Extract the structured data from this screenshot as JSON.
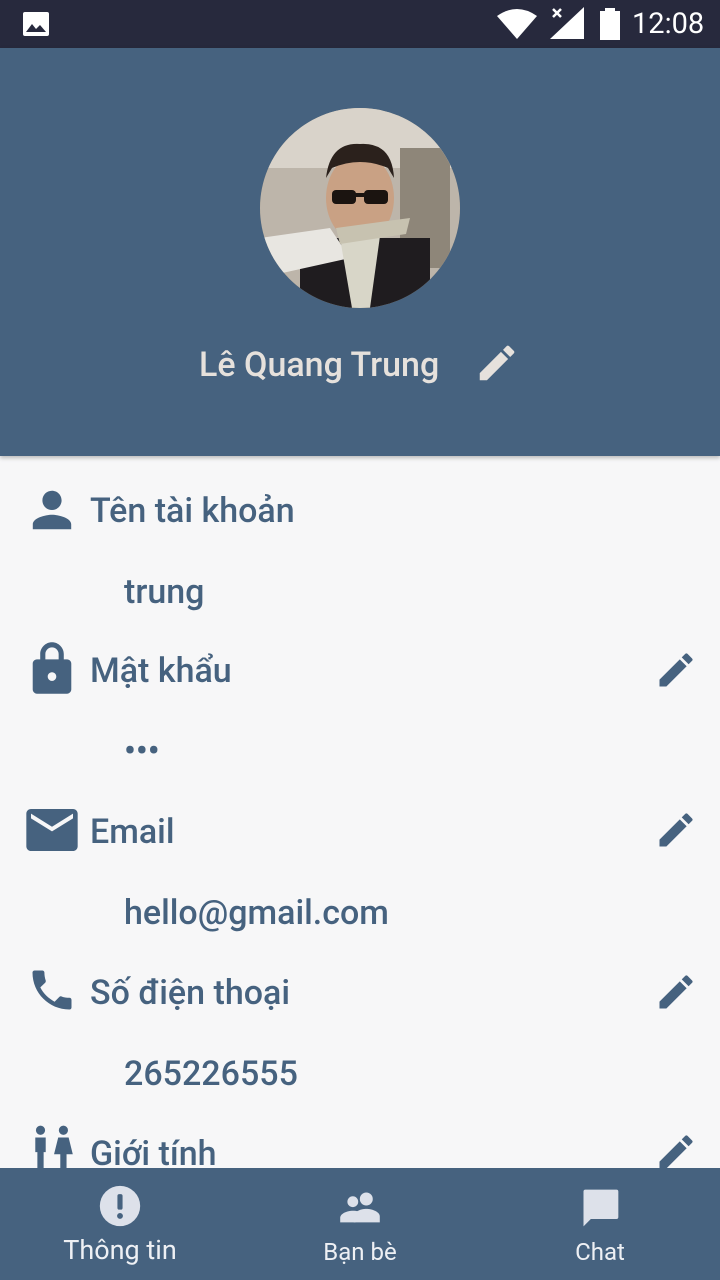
{
  "status_bar": {
    "time": "12:08",
    "icons": [
      "image-icon",
      "wifi-icon",
      "signal-icon",
      "battery-icon"
    ]
  },
  "profile": {
    "name": "Lê Quang Trung",
    "avatar": "profile-photo"
  },
  "fields": [
    {
      "icon": "person-icon",
      "label": "Tên tài khoản",
      "value": "trung",
      "editable": false
    },
    {
      "icon": "lock-icon",
      "label": "Mật khẩu",
      "value": "•••",
      "editable": true
    },
    {
      "icon": "mail-icon",
      "label": "Email",
      "value": "hello@gmail.com",
      "editable": true
    },
    {
      "icon": "phone-icon",
      "label": "Số điện thoại",
      "value": "265226555",
      "editable": true
    },
    {
      "icon": "gender-icon",
      "label": "Giới tính",
      "value": "",
      "editable": true
    }
  ],
  "bottom_nav": [
    {
      "icon": "info-alert-icon",
      "label": "Thông tin"
    },
    {
      "icon": "friends-icon",
      "label": "Bạn bè"
    },
    {
      "icon": "chat-icon",
      "label": "Chat"
    }
  ],
  "colors": {
    "primary": "#46627f",
    "status_bar": "#27293d",
    "background": "#f7f7f8",
    "header_text": "#e6e1dc"
  }
}
